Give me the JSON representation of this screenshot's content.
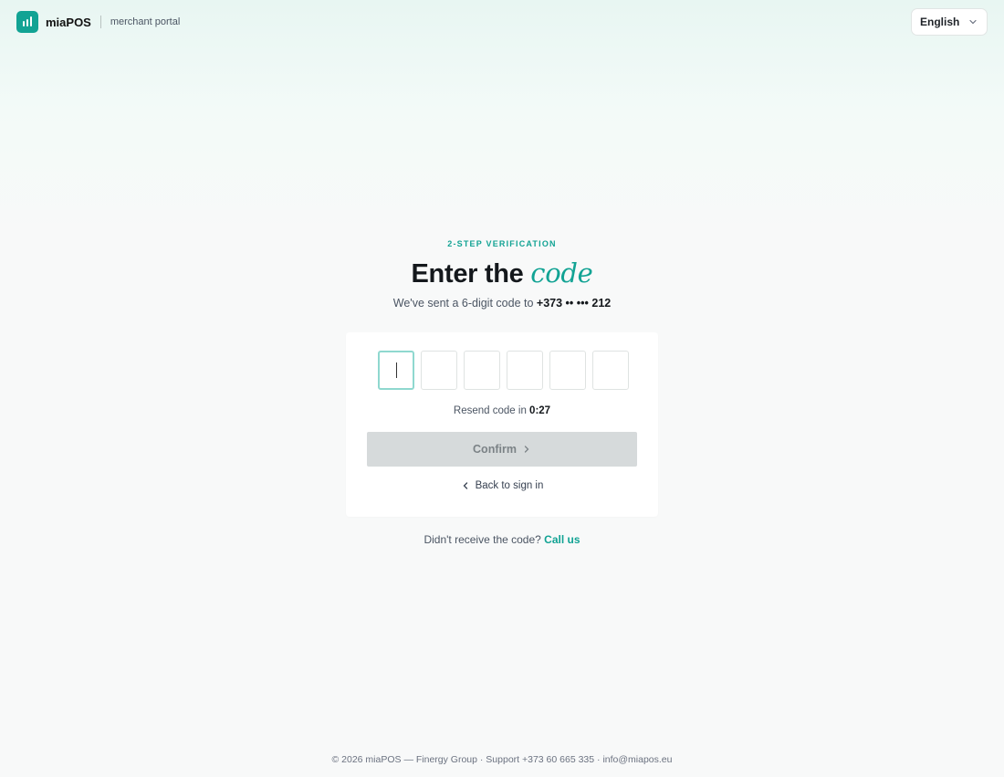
{
  "header": {
    "brand": "miaPOS",
    "subtitle": "merchant portal",
    "logo_icon": "bar-chart-icon",
    "language": "English"
  },
  "verify": {
    "eyebrow": "2-STEP VERIFICATION",
    "title_main": "Enter the",
    "title_accent": "code",
    "sent_prefix": "We've sent a 6-digit code to",
    "phone_masked": "+373 •• ••• 212",
    "otp_digits": [
      "",
      "",
      "",
      "",
      "",
      ""
    ],
    "resend_prefix": "Resend code in",
    "resend_timer": "0:27",
    "confirm_label": "Confirm",
    "back_label": "Back to sign in"
  },
  "help": {
    "question": "Didn't receive the code?",
    "link": "Call us"
  },
  "footer": {
    "text": "© 2026 miaPOS — Finergy Group · Support +373 60 665 335 · info@miapos.eu"
  },
  "colors": {
    "accent": "#12a394",
    "disabled_button": "#d6dadb"
  }
}
